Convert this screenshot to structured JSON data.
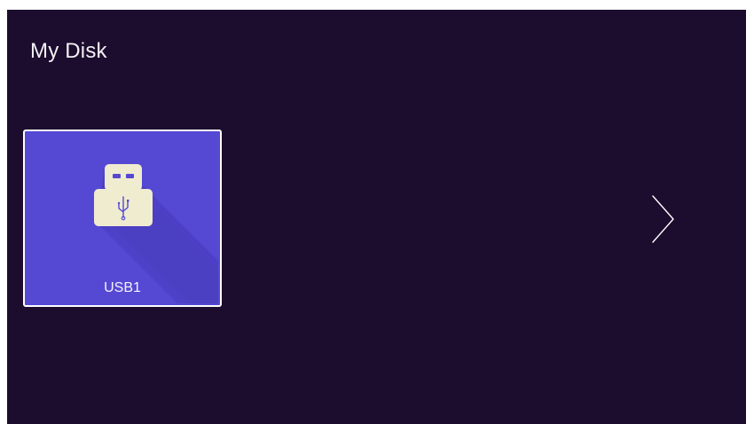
{
  "screen": {
    "title": "My Disk"
  },
  "disks": [
    {
      "label": "USB1",
      "icon": "usb-drive-icon",
      "selected": true
    }
  ],
  "navigation": {
    "next_icon": "chevron-right-icon"
  },
  "colors": {
    "background": "#1c0c2d",
    "tile": "#5548d3",
    "tile_border": "#ffffff",
    "icon_body": "#efeccf",
    "icon_symbol": "#5548d3",
    "text": "#f2f0f5"
  }
}
